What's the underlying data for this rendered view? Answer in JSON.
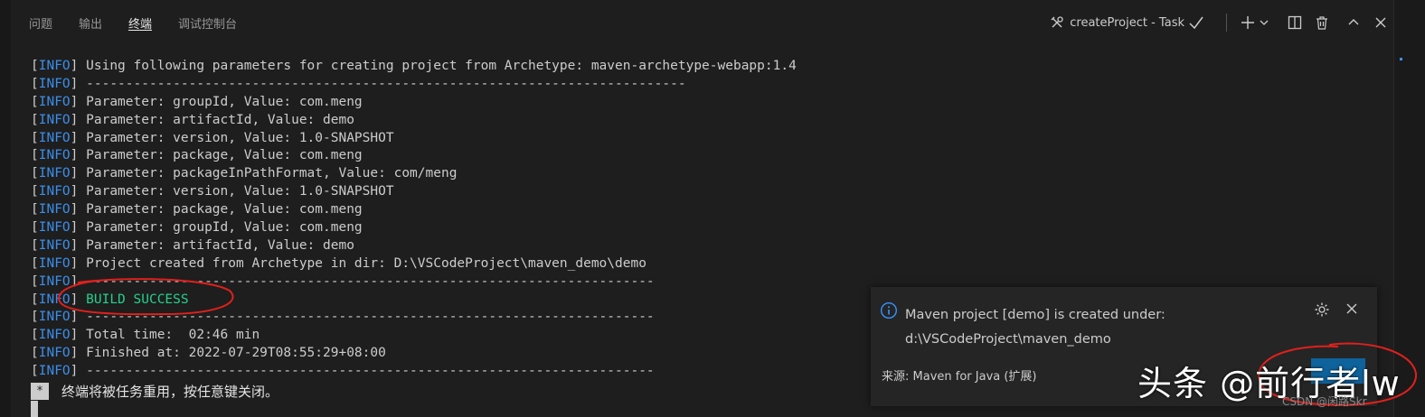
{
  "tabs": [
    {
      "label": "问题",
      "active": false
    },
    {
      "label": "输出",
      "active": false
    },
    {
      "label": "终端",
      "active": true
    },
    {
      "label": "调试控制台",
      "active": false
    }
  ],
  "header": {
    "task_label": "createProject - Task",
    "icons": [
      "tools-icon",
      "check-icon",
      "plus-icon",
      "chevron-down-icon",
      "split-icon",
      "trash-icon",
      "chevron-up-icon",
      "close-icon"
    ]
  },
  "terminal": {
    "lines": [
      {
        "level": "INFO",
        "text": "Using following parameters for creating project from Archetype: maven-archetype-webapp:1.4"
      },
      {
        "level": "INFO",
        "text": "----------------------------------------------------------------------------"
      },
      {
        "level": "INFO",
        "text": "Parameter: groupId, Value: com.meng"
      },
      {
        "level": "INFO",
        "text": "Parameter: artifactId, Value: demo"
      },
      {
        "level": "INFO",
        "text": "Parameter: version, Value: 1.0-SNAPSHOT"
      },
      {
        "level": "INFO",
        "text": "Parameter: package, Value: com.meng"
      },
      {
        "level": "INFO",
        "text": "Parameter: packageInPathFormat, Value: com/meng"
      },
      {
        "level": "INFO",
        "text": "Parameter: version, Value: 1.0-SNAPSHOT"
      },
      {
        "level": "INFO",
        "text": "Parameter: package, Value: com.meng"
      },
      {
        "level": "INFO",
        "text": "Parameter: groupId, Value: com.meng"
      },
      {
        "level": "INFO",
        "text": "Parameter: artifactId, Value: demo"
      },
      {
        "level": "INFO",
        "text": "Project created from Archetype in dir: D:\\VSCodeProject\\maven_demo\\demo"
      },
      {
        "level": "INFO",
        "text": "------------------------------------------------------------------------"
      },
      {
        "level": "INFO",
        "text": "BUILD SUCCESS",
        "success": true
      },
      {
        "level": "INFO",
        "text": "------------------------------------------------------------------------"
      },
      {
        "level": "INFO",
        "text": "Total time:  02:46 min"
      },
      {
        "level": "INFO",
        "text": "Finished at: 2022-07-29T08:55:29+08:00"
      },
      {
        "level": "INFO",
        "text": "------------------------------------------------------------------------"
      }
    ],
    "note_marker": "*",
    "note": "终端将被任务重用，按任意键关闭。"
  },
  "notification": {
    "message": "Maven project [demo] is created under: d:\\VSCodeProject\\maven_demo",
    "source": "来源: Maven for Java (扩展)",
    "icons": [
      "info-icon",
      "gear-icon",
      "close-icon"
    ]
  },
  "overlay": {
    "watermark": "头条 @前行者lw",
    "small_watermark": "CSDN @闲路Skr"
  },
  "colors": {
    "background": "#1e1e1e",
    "info_tag": "#3b8eea",
    "success": "#23d18b",
    "notification_bg": "#252526",
    "button": "#0e639c",
    "annotation": "#e0201c"
  }
}
